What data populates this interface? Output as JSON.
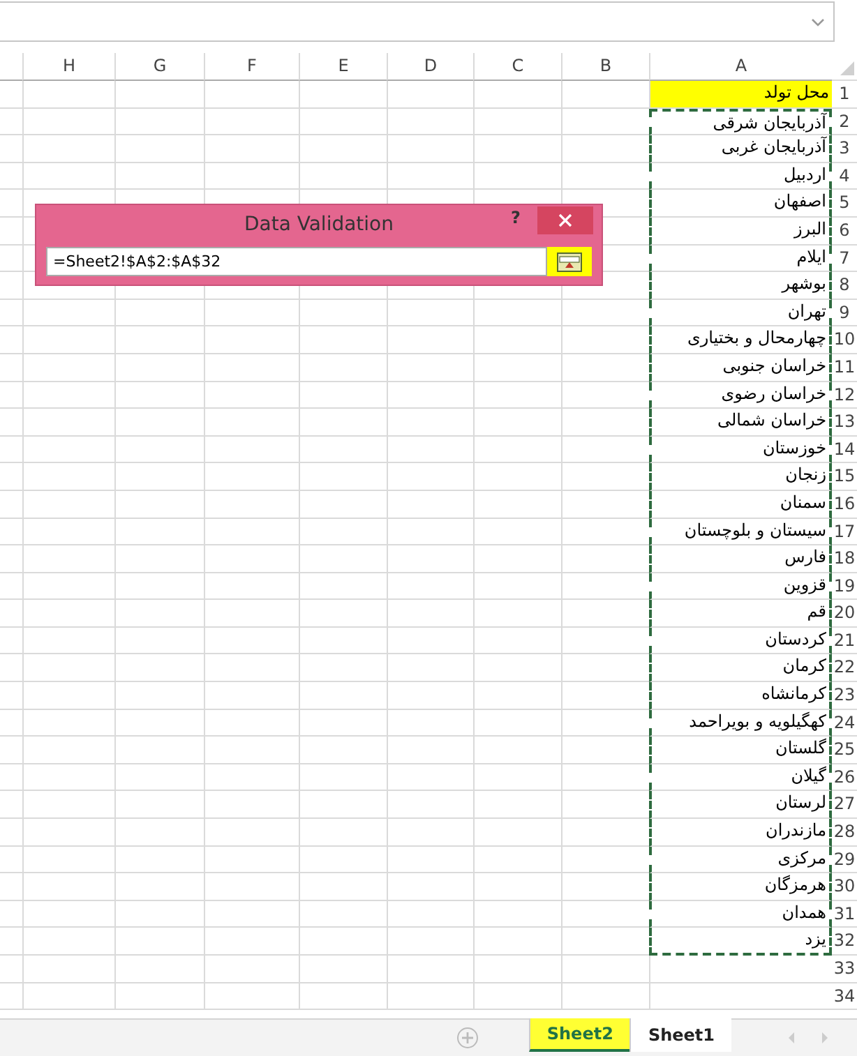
{
  "formula_bar": {
    "expanded": false
  },
  "columns": [
    "A",
    "B",
    "C",
    "D",
    "E",
    "F",
    "G",
    "H"
  ],
  "rows": [
    {
      "number": "1",
      "a": "محل تولد",
      "highlighted": true,
      "marked": false
    },
    {
      "number": "2",
      "a": "آذربایجان شرقی",
      "highlighted": false,
      "marked": true
    },
    {
      "number": "3",
      "a": "آذربایجان غربی",
      "highlighted": false,
      "marked": true
    },
    {
      "number": "4",
      "a": "اردبیل",
      "highlighted": false,
      "marked": true
    },
    {
      "number": "5",
      "a": "اصفهان",
      "highlighted": false,
      "marked": true
    },
    {
      "number": "6",
      "a": "البرز",
      "highlighted": false,
      "marked": true
    },
    {
      "number": "7",
      "a": "ایلام",
      "highlighted": false,
      "marked": true
    },
    {
      "number": "8",
      "a": "بوشهر",
      "highlighted": false,
      "marked": true
    },
    {
      "number": "9",
      "a": "تهران",
      "highlighted": false,
      "marked": true
    },
    {
      "number": "10",
      "a": "چهارمحال و بختیاری",
      "highlighted": false,
      "marked": true
    },
    {
      "number": "11",
      "a": "خراسان جنوبی",
      "highlighted": false,
      "marked": true
    },
    {
      "number": "12",
      "a": "خراسان رضوی",
      "highlighted": false,
      "marked": true
    },
    {
      "number": "13",
      "a": "خراسان شمالی",
      "highlighted": false,
      "marked": true
    },
    {
      "number": "14",
      "a": "خوزستان",
      "highlighted": false,
      "marked": true
    },
    {
      "number": "15",
      "a": "زنجان",
      "highlighted": false,
      "marked": true
    },
    {
      "number": "16",
      "a": "سمنان",
      "highlighted": false,
      "marked": true
    },
    {
      "number": "17",
      "a": "سیستان و بلوچستان",
      "highlighted": false,
      "marked": true
    },
    {
      "number": "18",
      "a": "فارس",
      "highlighted": false,
      "marked": true
    },
    {
      "number": "19",
      "a": "قزوین",
      "highlighted": false,
      "marked": true
    },
    {
      "number": "20",
      "a": "قم",
      "highlighted": false,
      "marked": true
    },
    {
      "number": "21",
      "a": "کردستان",
      "highlighted": false,
      "marked": true
    },
    {
      "number": "22",
      "a": "کرمان",
      "highlighted": false,
      "marked": true
    },
    {
      "number": "23",
      "a": "کرمانشاه",
      "highlighted": false,
      "marked": true
    },
    {
      "number": "24",
      "a": "کهگیلویه و بویراحمد",
      "highlighted": false,
      "marked": true
    },
    {
      "number": "25",
      "a": "گلستان",
      "highlighted": false,
      "marked": true
    },
    {
      "number": "26",
      "a": "گیلان",
      "highlighted": false,
      "marked": true
    },
    {
      "number": "27",
      "a": "لرستان",
      "highlighted": false,
      "marked": true
    },
    {
      "number": "28",
      "a": "مازندران",
      "highlighted": false,
      "marked": true
    },
    {
      "number": "29",
      "a": "مرکزی",
      "highlighted": false,
      "marked": true
    },
    {
      "number": "30",
      "a": "هرمزگان",
      "highlighted": false,
      "marked": true
    },
    {
      "number": "31",
      "a": "همدان",
      "highlighted": false,
      "marked": true
    },
    {
      "number": "32",
      "a": "یزد",
      "highlighted": false,
      "marked": true
    },
    {
      "number": "33",
      "highlighted": false,
      "marked": false
    },
    {
      "number": "34",
      "highlighted": false,
      "marked": false
    }
  ],
  "dialog": {
    "title": "Data Validation",
    "help": "?",
    "value": "=Sheet2!$A$2:$A$32",
    "button_highlighted": true
  },
  "sheet_tabs": [
    {
      "label": "Sheet1",
      "selected": false,
      "highlighted": false
    },
    {
      "label": "Sheet2",
      "selected": true,
      "highlighted": true
    }
  ]
}
